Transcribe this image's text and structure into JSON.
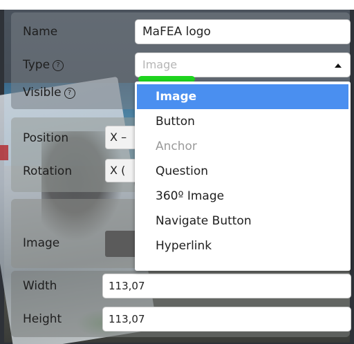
{
  "form": {
    "name_label": "Name",
    "name_value": "MaFEA logo",
    "type_label": "Type",
    "type_selected": "Image",
    "visible_label": "Visible",
    "help_glyph": "?",
    "position_label": "Position",
    "position_x_label": "X",
    "position_x_partial": "–",
    "rotation_label": "Rotation",
    "rotation_x_label": "X",
    "rotation_x_partial": "(",
    "image_label": "Image",
    "width_label": "Width",
    "width_value": "113,07",
    "height_label": "Height",
    "height_value": "113,07"
  },
  "dropdown": {
    "options": [
      {
        "label": "Image",
        "state": "selected"
      },
      {
        "label": "Button",
        "state": "normal"
      },
      {
        "label": "Anchor",
        "state": "disabled"
      },
      {
        "label": "Question",
        "state": "normal"
      },
      {
        "label": "360º Image",
        "state": "normal"
      },
      {
        "label": "Navigate Button",
        "state": "normal"
      },
      {
        "label": "Hyperlink",
        "state": "normal"
      }
    ]
  },
  "colors": {
    "selected_option": "#4a8ff0",
    "highlight_mark": "#1ed41e",
    "disabled_text": "#9a9a9a"
  }
}
